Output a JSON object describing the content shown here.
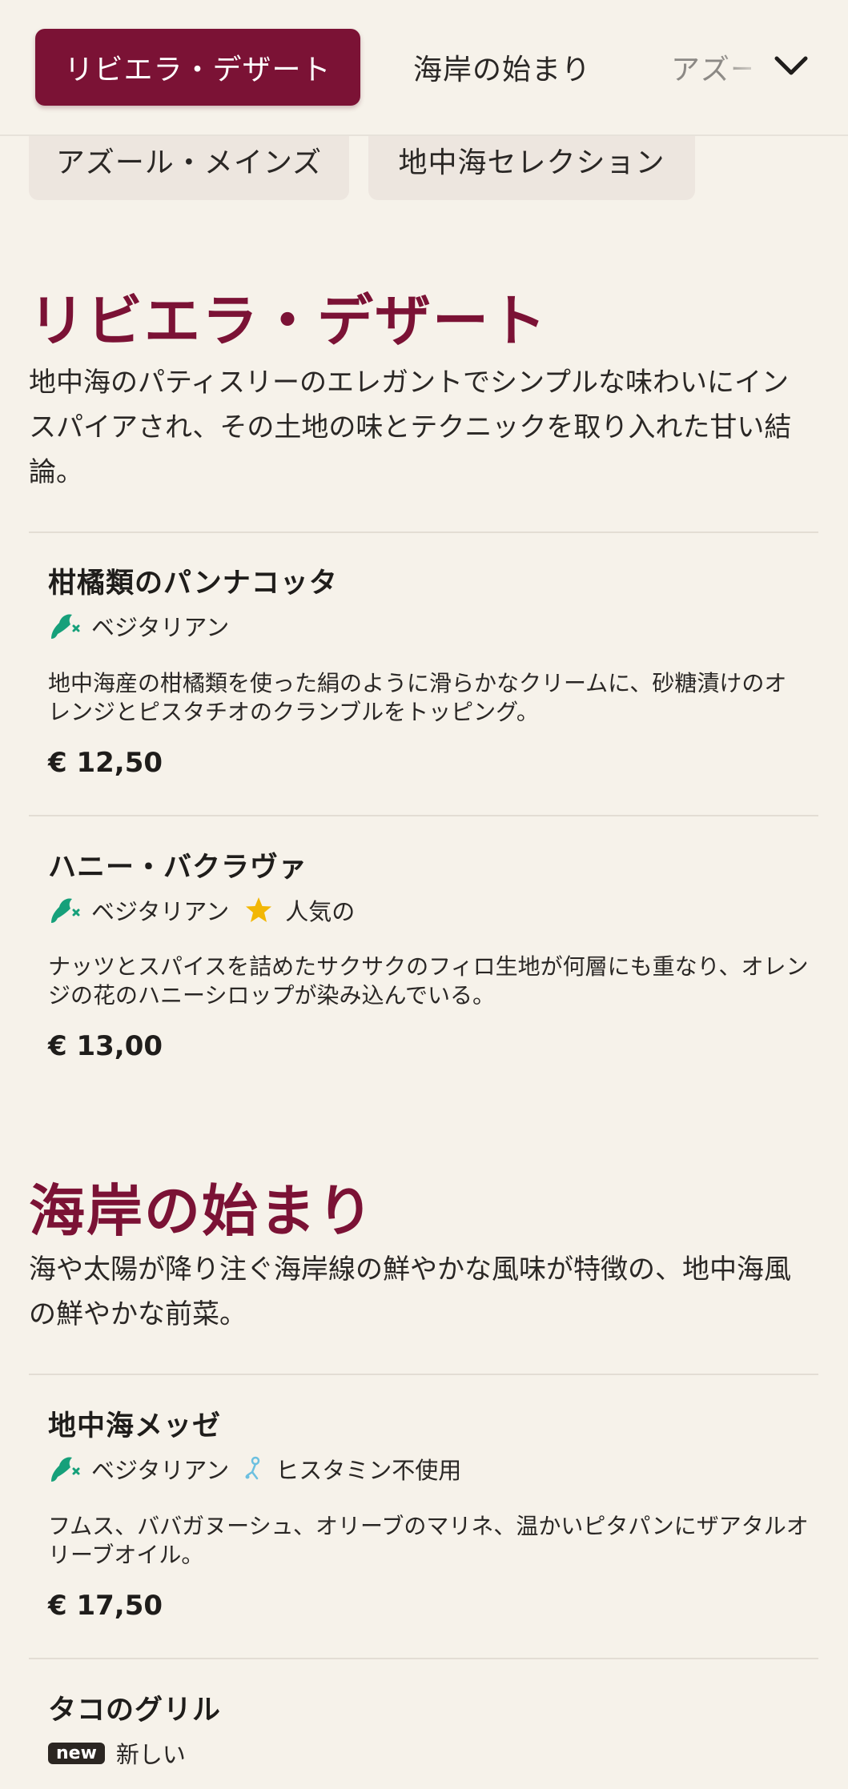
{
  "nav": {
    "active_tab": "リビエラ・デザート",
    "tab_2": "海岸の始まり",
    "tab_3": "アズール・メインズ",
    "chip_1": "アズール・メインズ",
    "chip_2": "地中海セレクション"
  },
  "sections": [
    {
      "title": "リビエラ・デザート",
      "description": "地中海のパティスリーのエレガントでシンプルな味わいにインスパイアされ、その土地の味とテクニックを取り入れた甘い結論。",
      "items": [
        {
          "name": "柑橘類のパンナコッタ",
          "tags": [
            "ベジタリアン"
          ],
          "description": "地中海産の柑橘類を使った絹のように滑らかなクリームに、砂糖漬けのオレンジとピスタチオのクランブルをトッピング。",
          "price": "€ 12,50"
        },
        {
          "name": "ハニー・バクラヴァ",
          "tags": [
            "ベジタリアン",
            "人気の"
          ],
          "description": "ナッツとスパイスを詰めたサクサクのフィロ生地が何層にも重なり、オレンジの花のハニーシロップが染み込んでいる。",
          "price": "€ 13,00"
        }
      ]
    },
    {
      "title": "海岸の始まり",
      "description": "海や太陽が降り注ぐ海岸線の鮮やかな風味が特徴の、地中海風の鮮やかな前菜。",
      "items": [
        {
          "name": "地中海メッゼ",
          "tags": [
            "ベジタリアン",
            "ヒスタミン不使用"
          ],
          "description": "フムス、ババガヌーシュ、オリーブのマリネ、温かいピタパンにザアタルオリーブオイル。",
          "price": "€ 17,50"
        },
        {
          "name": "タコのグリル",
          "badge": "new",
          "tags": [
            "新しい"
          ]
        }
      ]
    }
  ],
  "colors": {
    "accent": "#7b1235",
    "background": "#f6f2ea",
    "vegetarian": "#16a07a",
    "star": "#f2b705",
    "histamine": "#6cc0e0"
  },
  "icons": [
    "chevron-down-icon",
    "vegetarian-icon",
    "star-icon",
    "histamine-free-icon"
  ]
}
